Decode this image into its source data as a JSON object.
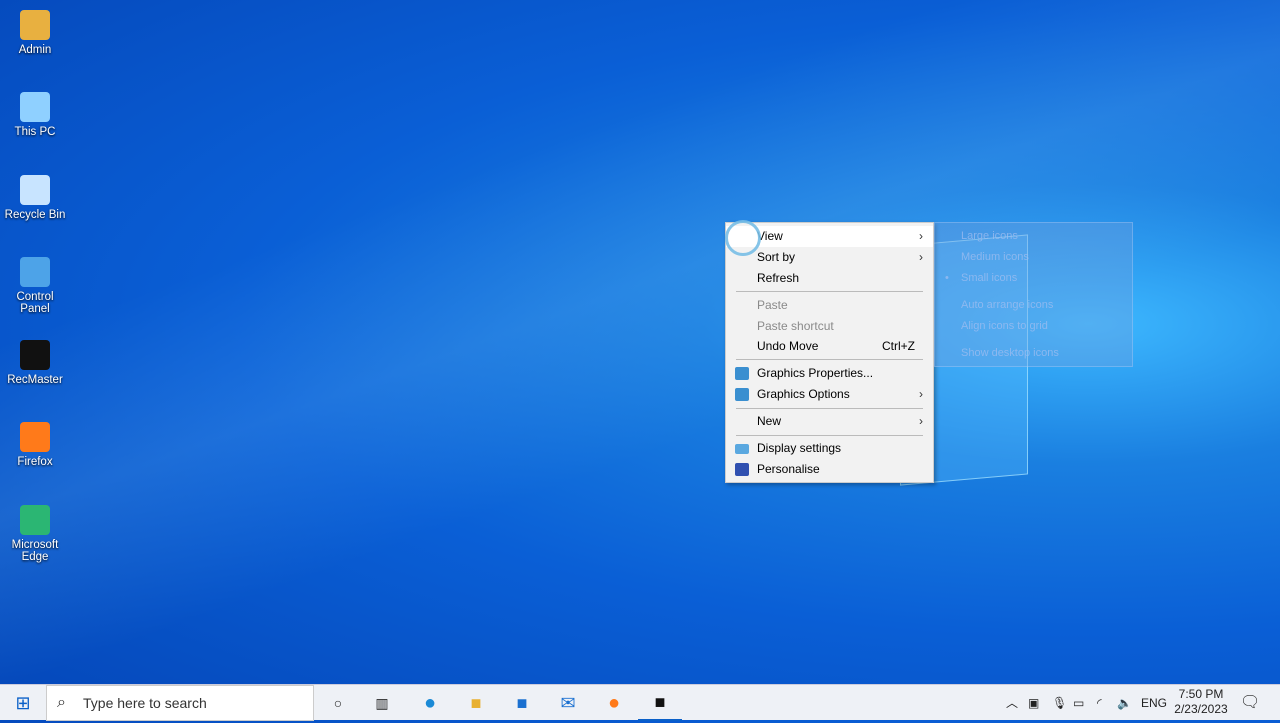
{
  "desktop_icons": [
    {
      "label": "Admin",
      "color": "#e8b040"
    },
    {
      "label": "This PC",
      "color": "#8fd0ff"
    },
    {
      "label": "Recycle Bin",
      "color": "#c8e4ff"
    },
    {
      "label": "Control Panel",
      "color": "#4da3e8"
    },
    {
      "label": "RecMaster",
      "color": "#111111"
    },
    {
      "label": "Firefox",
      "color": "#ff7a1a"
    },
    {
      "label": "Microsoft Edge",
      "color": "#2bb673"
    }
  ],
  "context_menu": {
    "view": "View",
    "sort_by": "Sort by",
    "refresh": "Refresh",
    "paste": "Paste",
    "paste_shortcut": "Paste shortcut",
    "undo_move": "Undo Move",
    "undo_shortcut": "Ctrl+Z",
    "graphics_properties": "Graphics Properties...",
    "graphics_options": "Graphics Options",
    "new": "New",
    "display_settings": "Display settings",
    "personalise": "Personalise"
  },
  "view_submenu": {
    "large": "Large icons",
    "medium": "Medium icons",
    "small": "Small icons",
    "auto_arrange": "Auto arrange icons",
    "align": "Align icons to grid",
    "show": "Show desktop icons"
  },
  "taskbar": {
    "search_placeholder": "Type here to search",
    "language": "ENG",
    "time": "7:50 PM",
    "date": "2/23/2023"
  }
}
